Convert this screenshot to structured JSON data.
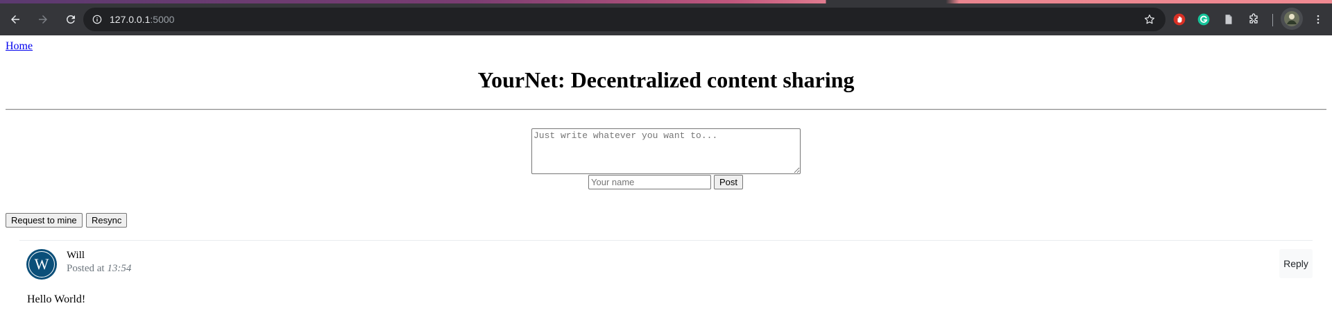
{
  "browser": {
    "url_host": "127.0.0.1",
    "url_port": ":5000",
    "icons": {
      "back": "arrow-left-icon",
      "forward": "arrow-right-icon",
      "reload": "reload-icon",
      "site_info": "info-icon",
      "bookmark": "star-icon",
      "extensions": [
        "hand-stop-icon",
        "grammarly-icon",
        "document-icon",
        "puzzle-icon"
      ],
      "profile": "avatar-icon",
      "menu": "kebab-menu-icon"
    }
  },
  "nav": {
    "home_label": "Home"
  },
  "header": {
    "title": "YourNet: Decentralized content sharing"
  },
  "composer": {
    "content_placeholder": "Just write whatever you want to...",
    "name_placeholder": "Your name",
    "post_label": "Post"
  },
  "actions": {
    "mine_label": "Request to mine",
    "resync_label": "Resync"
  },
  "posts": [
    {
      "avatar_letter": "W",
      "author": "Will",
      "posted_prefix": "Posted at",
      "time": "13:54",
      "reply_label": "Reply",
      "content": "Hello World!"
    }
  ],
  "colors": {
    "chrome_bg": "#35363a",
    "omnibox_bg": "#202124",
    "avatar_bg": "#0b4f79",
    "link": "#0000ee",
    "muted_text": "#6c757d"
  }
}
